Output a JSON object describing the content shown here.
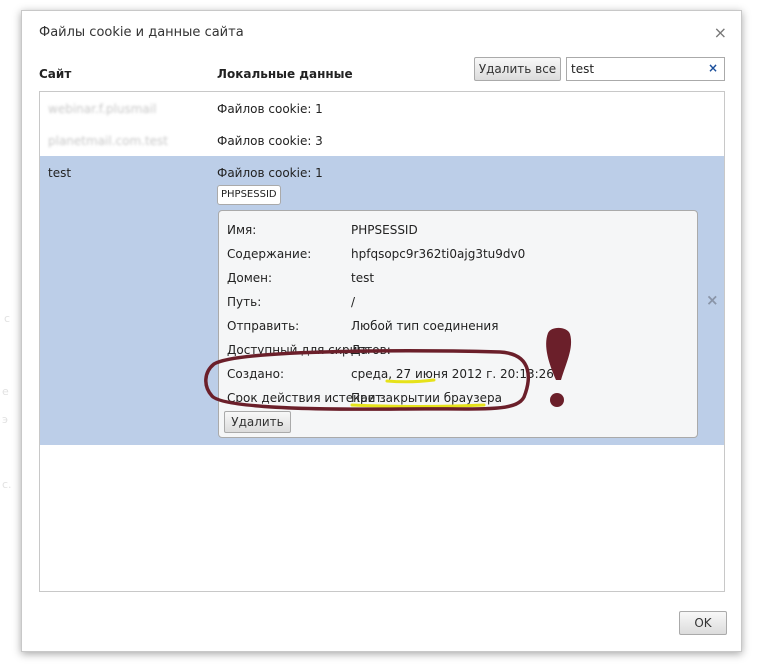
{
  "background": {
    "faint_texts": [
      "с",
      "е",
      "э",
      "с."
    ]
  },
  "dialog": {
    "title": "Файлы cookie и данные сайта",
    "close_glyph": "×"
  },
  "columns": {
    "site": "Сайт",
    "local": "Локальные данные"
  },
  "toolbar": {
    "delete_all_label": "Удалить все",
    "search_value": "test",
    "search_clear_glyph": "×"
  },
  "rows": [
    {
      "site": "webinar.f.plusmail",
      "local": "Файлов cookie: 1"
    },
    {
      "site": "planetmail.com.test",
      "local": "Файлов cookie: 3"
    },
    {
      "site": "test",
      "local": "Файлов cookie: 1"
    }
  ],
  "selected_row": {
    "chip_label": "PHPSESSID",
    "remove_row_glyph": "×",
    "details": [
      {
        "key": "Имя:",
        "value": "PHPSESSID"
      },
      {
        "key": "Содержание:",
        "value": "hpfqsopc9r362ti0ajg3tu9dv0"
      },
      {
        "key": "Домен:",
        "value": "test"
      },
      {
        "key": "Путь:",
        "value": "/"
      },
      {
        "key": "Отправить:",
        "value": "Любой тип соединения"
      },
      {
        "key": "Доступный для скриптов:",
        "value": "Да"
      },
      {
        "key": "Создано:",
        "value": "среда, 27 июня 2012 г. 20:13:26"
      },
      {
        "key": "Срок действия истекает:",
        "value": "При закрытии браузера"
      }
    ],
    "delete_label": "Удалить"
  },
  "footer": {
    "ok_label": "OK"
  },
  "colors": {
    "selected_row": "#bccee8",
    "annotation": "#6b1f2a",
    "highlight": "#e6e21a"
  },
  "annotation": {
    "mark": "exclamation"
  }
}
